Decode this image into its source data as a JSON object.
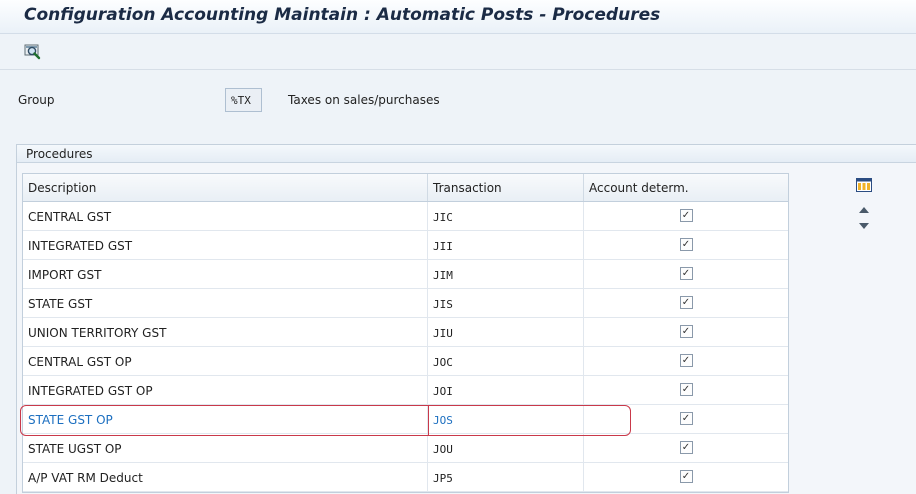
{
  "window": {
    "title": "Configuration Accounting Maintain : Automatic Posts - Procedures"
  },
  "toolbar": {
    "icons": [
      "find-icon"
    ]
  },
  "header": {
    "group_label": "Group",
    "group_value": "%TX",
    "group_text": "Taxes on sales/purchases"
  },
  "procedures": {
    "title": "Procedures",
    "columns": [
      "Description",
      "Transaction",
      "Account determ."
    ],
    "rows": [
      {
        "description": "CENTRAL GST",
        "transaction": "JIC",
        "account_determ": true
      },
      {
        "description": "INTEGRATED GST",
        "transaction": "JII",
        "account_determ": true
      },
      {
        "description": "IMPORT GST",
        "transaction": "JIM",
        "account_determ": true
      },
      {
        "description": "STATE GST",
        "transaction": "JIS",
        "account_determ": true
      },
      {
        "description": "UNION TERRITORY GST",
        "transaction": "JIU",
        "account_determ": true
      },
      {
        "description": "CENTRAL GST OP",
        "transaction": "JOC",
        "account_determ": true
      },
      {
        "description": "INTEGRATED GST OP",
        "transaction": "JOI",
        "account_determ": true
      },
      {
        "description": "STATE GST OP",
        "transaction": "JOS",
        "account_determ": true
      },
      {
        "description": "STATE UGST OP",
        "transaction": "JOU",
        "account_determ": true
      },
      {
        "description": "A/P VAT RM Deduct",
        "transaction": "JP5",
        "account_determ": true
      }
    ],
    "selected_row": 7
  },
  "colors": {
    "highlight": "#c9394a",
    "selected_text": "#1c6fc0",
    "title": "#1b2b45"
  }
}
